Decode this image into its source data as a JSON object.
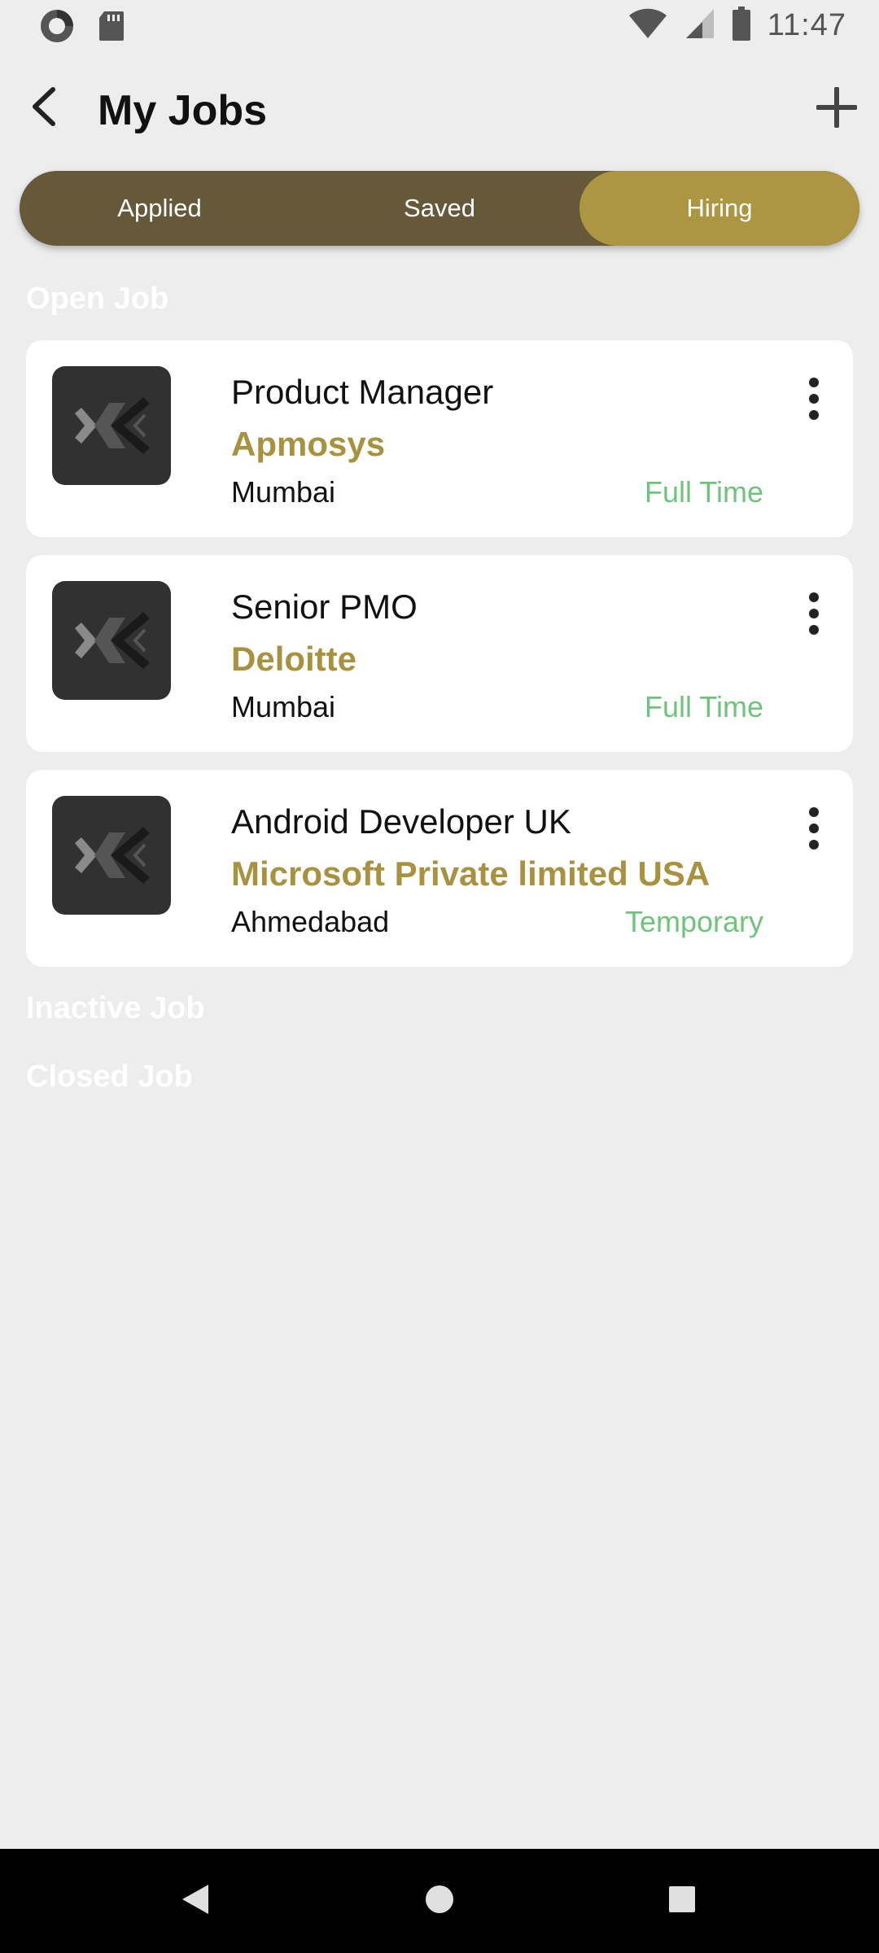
{
  "status_bar": {
    "time": "11:47",
    "icons": [
      "sync-icon",
      "sd-card-icon",
      "wifi-icon",
      "signal-icon",
      "battery-icon"
    ]
  },
  "appbar": {
    "title": "My Jobs",
    "back_icon": "back-arrow-icon",
    "add_icon": "plus-icon"
  },
  "tabs": [
    {
      "label": "Applied",
      "active": false
    },
    {
      "label": "Saved",
      "active": false
    },
    {
      "label": "Hiring",
      "active": true
    }
  ],
  "sections": {
    "open": "Open Job",
    "inactive": "Inactive Job",
    "closed": "Closed Job"
  },
  "jobs": [
    {
      "title": "Product Manager",
      "company": "Apmosys",
      "location": "Mumbai",
      "type": "Full Time"
    },
    {
      "title": "Senior PMO",
      "company": "Deloitte",
      "location": "Mumbai",
      "type": "Full Time"
    },
    {
      "title": "Android Developer UK",
      "company": "Microsoft Private limited USA",
      "location": "Ahmedabad",
      "type": "Temporary"
    }
  ],
  "colors": {
    "accent": "#AD9642",
    "segment_bg": "#66593A",
    "company_text": "#A8913F",
    "job_type_text": "#6FC47B",
    "background": "#EDEDED"
  },
  "nav_bar": {
    "icons": [
      "nav-back-icon",
      "nav-home-icon",
      "nav-recents-icon"
    ]
  }
}
